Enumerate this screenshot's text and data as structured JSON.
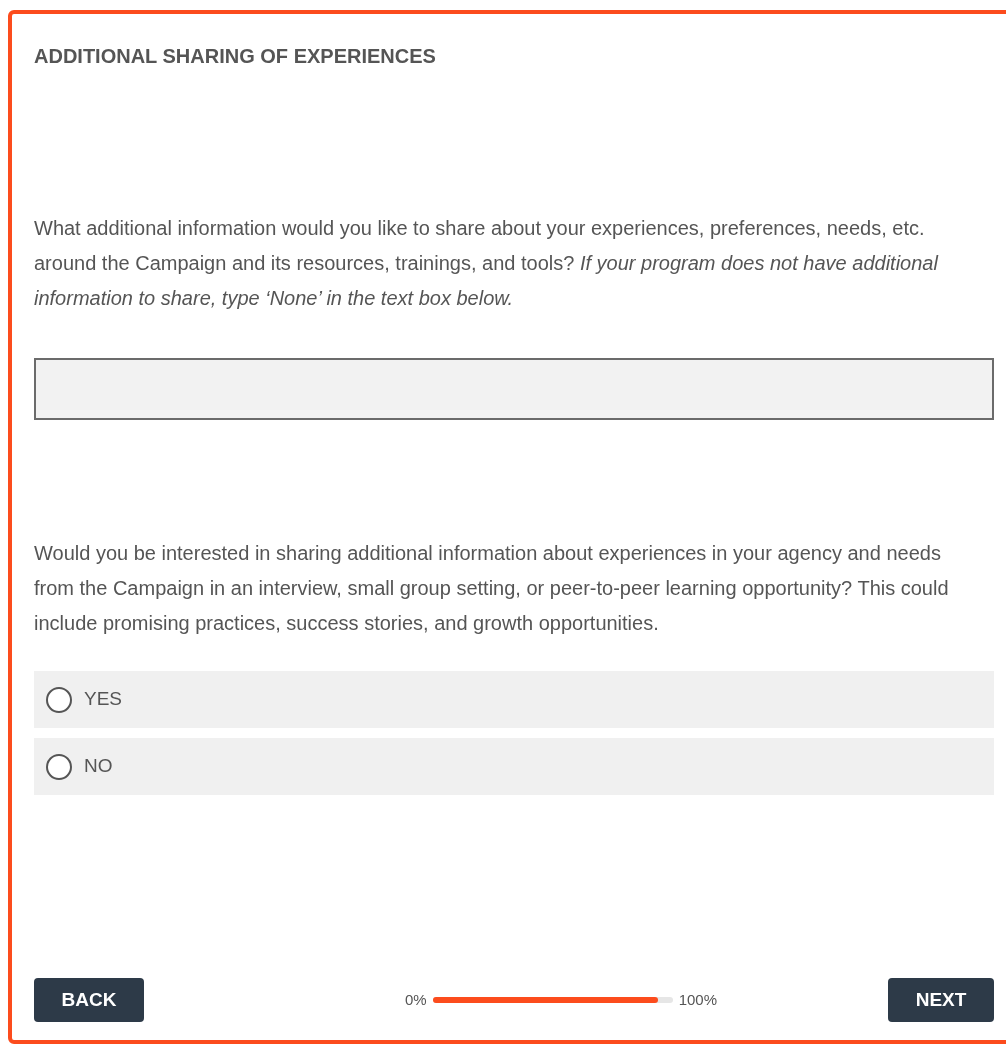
{
  "section_title": "ADDITIONAL SHARING OF EXPERIENCES",
  "questions": [
    {
      "kind": "text",
      "prompt": "What additional information would you like to share about your experiences, preferences, needs, etc. around the Campaign and its resources, trainings, and tools? *If your program does not have additional information to share, type ‘None’ in the text box below.*"
    },
    {
      "kind": "choice",
      "prompt": "Would you be interested in sharing additional information about experiences in your agency and needs from the Campaign in an interview, small group setting, or peer-to-peer learning opportunity? This could include promising practices, success stories, and growth opportunities.",
      "options": [
        {
          "label": "YES",
          "selected": false
        },
        {
          "label": "NO",
          "selected": false
        }
      ]
    }
  ],
  "footer": {
    "back": "BACK",
    "next": "NEXT",
    "progress": {
      "start": "0%",
      "end": "100%",
      "level": 0.94
    }
  }
}
